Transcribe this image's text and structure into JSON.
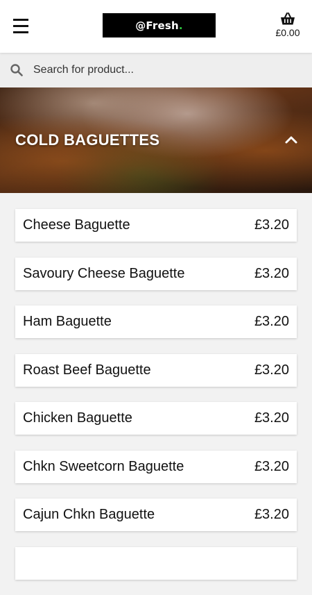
{
  "header": {
    "logo_text": "@Fresh",
    "logo_dot": ".",
    "cart_total": "£0.00"
  },
  "search": {
    "placeholder": "Search for product..."
  },
  "category": {
    "title": "COLD BAGUETTES"
  },
  "products": [
    {
      "name": "Cheese Baguette",
      "price": "£3.20"
    },
    {
      "name": "Savoury Cheese Baguette",
      "price": "£3.20"
    },
    {
      "name": "Ham Baguette",
      "price": "£3.20"
    },
    {
      "name": "Roast Beef Baguette",
      "price": "£3.20"
    },
    {
      "name": "Chicken Baguette",
      "price": "£3.20"
    },
    {
      "name": "Chkn Sweetcorn Baguette",
      "price": "£3.20"
    },
    {
      "name": "Cajun Chkn Baguette",
      "price": "£3.20"
    },
    {
      "name": "",
      "price": ""
    }
  ],
  "icons": {
    "menu": "hamburger-icon",
    "cart": "basket-icon",
    "search": "search-icon",
    "collapse": "chevron-up-icon"
  },
  "colors": {
    "logo_background": "#000000",
    "logo_dot": "#2ecc40",
    "header_background": "#ffffff",
    "search_background": "#eeeeee",
    "page_background": "#f2f2f2"
  }
}
